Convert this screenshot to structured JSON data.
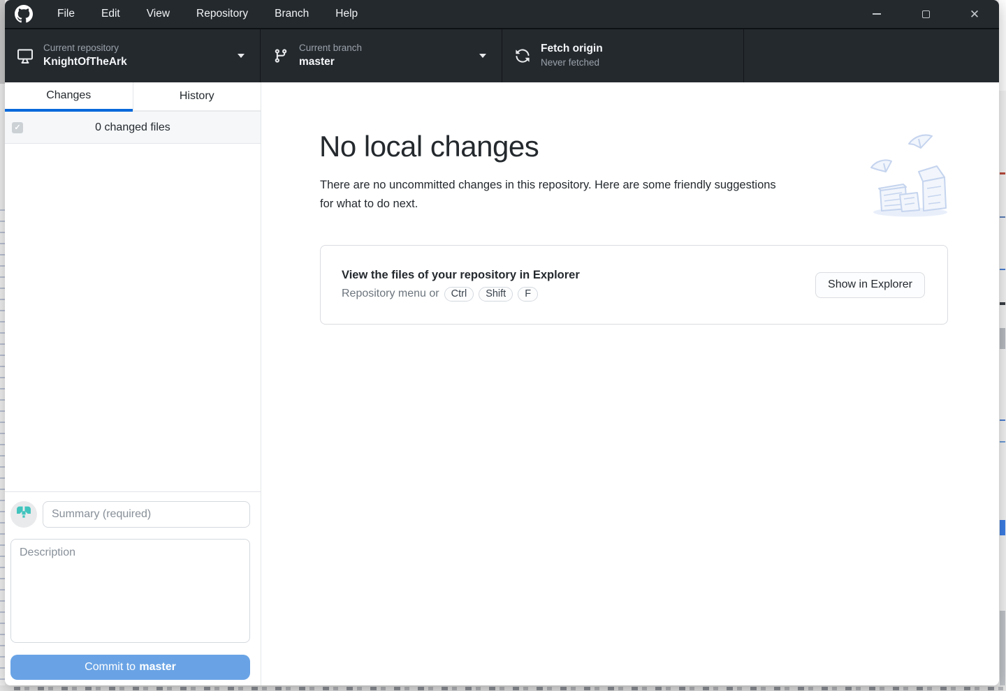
{
  "titlebar": {
    "menu": [
      "File",
      "Edit",
      "View",
      "Repository",
      "Branch",
      "Help"
    ]
  },
  "toolbar": {
    "repository": {
      "label": "Current repository",
      "value": "KnightOfTheArk"
    },
    "branch": {
      "label": "Current branch",
      "value": "master"
    },
    "fetch": {
      "label": "Fetch origin",
      "status": "Never fetched"
    }
  },
  "sidebar": {
    "tabs": {
      "changes": "Changes",
      "history": "History"
    },
    "files_summary": "0 changed files",
    "checkbox_glyph": "✓",
    "commit": {
      "summary_placeholder": "Summary (required)",
      "description_placeholder": "Description",
      "button_prefix": "Commit to",
      "button_branch": "master"
    }
  },
  "main": {
    "heading": "No local changes",
    "description": "There are no uncommitted changes in this repository. Here are some friendly suggestions for what to do next.",
    "card": {
      "title": "View the files of your repository in Explorer",
      "hint": "Repository menu or",
      "keys": [
        "Ctrl",
        "Shift",
        "F"
      ],
      "action": "Show in Explorer"
    }
  },
  "colors": {
    "titlebar_bg": "#24292e",
    "active_tab_underline": "#0969da",
    "commit_button": "#69a3e5",
    "identicon_teal": "#41c4bd"
  }
}
